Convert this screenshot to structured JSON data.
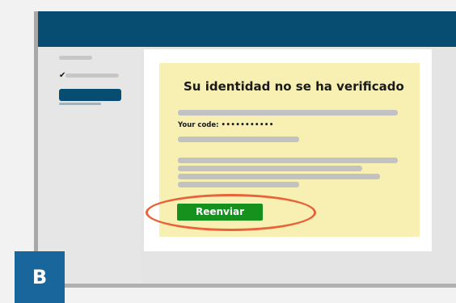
{
  "notice": {
    "title": "Su identidad no se ha verificado",
    "code_label": "Your code:",
    "code_value": "•••••••••••"
  },
  "actions": {
    "resend_label": "Reenviar"
  },
  "annotation": {
    "panel_label": "B"
  },
  "colors": {
    "header": "#074d72",
    "notice_bg": "#f7f0b2",
    "resend_button": "#17911d",
    "highlight_ring": "#e8623a",
    "badge": "#19669d"
  }
}
